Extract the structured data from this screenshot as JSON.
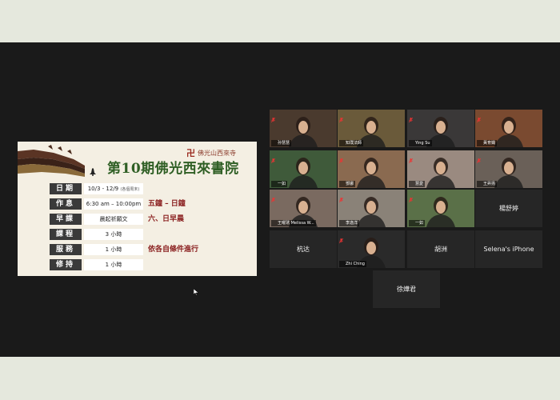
{
  "slide": {
    "temple_name": "佛光山西來寺",
    "title": "第10期佛光西來書院",
    "rows": [
      {
        "label": "日期",
        "value": "10/3 - 12/9",
        "note": "(各個周末)",
        "extra": ""
      },
      {
        "label": "作息",
        "value": "6:30 am – 10:00pm",
        "note": "",
        "extra": "五鐘 – 日鐘"
      },
      {
        "label": "早課",
        "value": "晨起祈願文",
        "note": "",
        "extra": "六、日早晨"
      },
      {
        "label": "課程",
        "value": "3 小時",
        "note": "",
        "extra": ""
      },
      {
        "label": "服務",
        "value": "1 小時",
        "note": "",
        "extra": "依各自條件進行"
      },
      {
        "label": "修持",
        "value": "1 小時",
        "note": "",
        "extra": ""
      }
    ]
  },
  "participants": [
    {
      "name": "孙慧慧",
      "type": "video",
      "color": "#4a3a2e",
      "active": false
    },
    {
      "name": "知璞法師",
      "type": "video",
      "color": "#6a5a3a",
      "active": true
    },
    {
      "name": "Ying Su",
      "type": "video",
      "color": "#3a3838",
      "active": false
    },
    {
      "name": "黃育嫻",
      "type": "video",
      "color": "#7a4a30",
      "active": false
    },
    {
      "name": "一如",
      "type": "video",
      "color": "#3f5a3a",
      "active": false
    },
    {
      "name": "鄧娜",
      "type": "video",
      "color": "#8a6a50",
      "active": false
    },
    {
      "name": "慧愛",
      "type": "video",
      "color": "#9a8a80",
      "active": false
    },
    {
      "name": "王昇扬",
      "type": "video",
      "color": "#6a6058",
      "active": false
    },
    {
      "name": "王曜琇 Melissa W...",
      "type": "video",
      "color": "#7a6a60",
      "active": false
    },
    {
      "name": "李逸洋",
      "type": "video",
      "color": "#8a8278",
      "active": false
    },
    {
      "name": "一如",
      "type": "video",
      "color": "#5a7048",
      "active": false
    },
    {
      "name": "楊舒婷",
      "type": "name",
      "color": "#262626",
      "active": false
    },
    {
      "name": "杭达",
      "type": "name",
      "color": "#262626",
      "active": false
    },
    {
      "name": "Zhi Ching",
      "type": "video",
      "color": "#2a2a2a",
      "active": false
    },
    {
      "name": "胡洲",
      "type": "name",
      "color": "#262626",
      "active": false
    },
    {
      "name": "Selena's iPhone",
      "type": "name",
      "color": "#262626",
      "active": false
    },
    {
      "name": "徐燁君",
      "type": "name",
      "color": "#262626",
      "active": false
    }
  ]
}
